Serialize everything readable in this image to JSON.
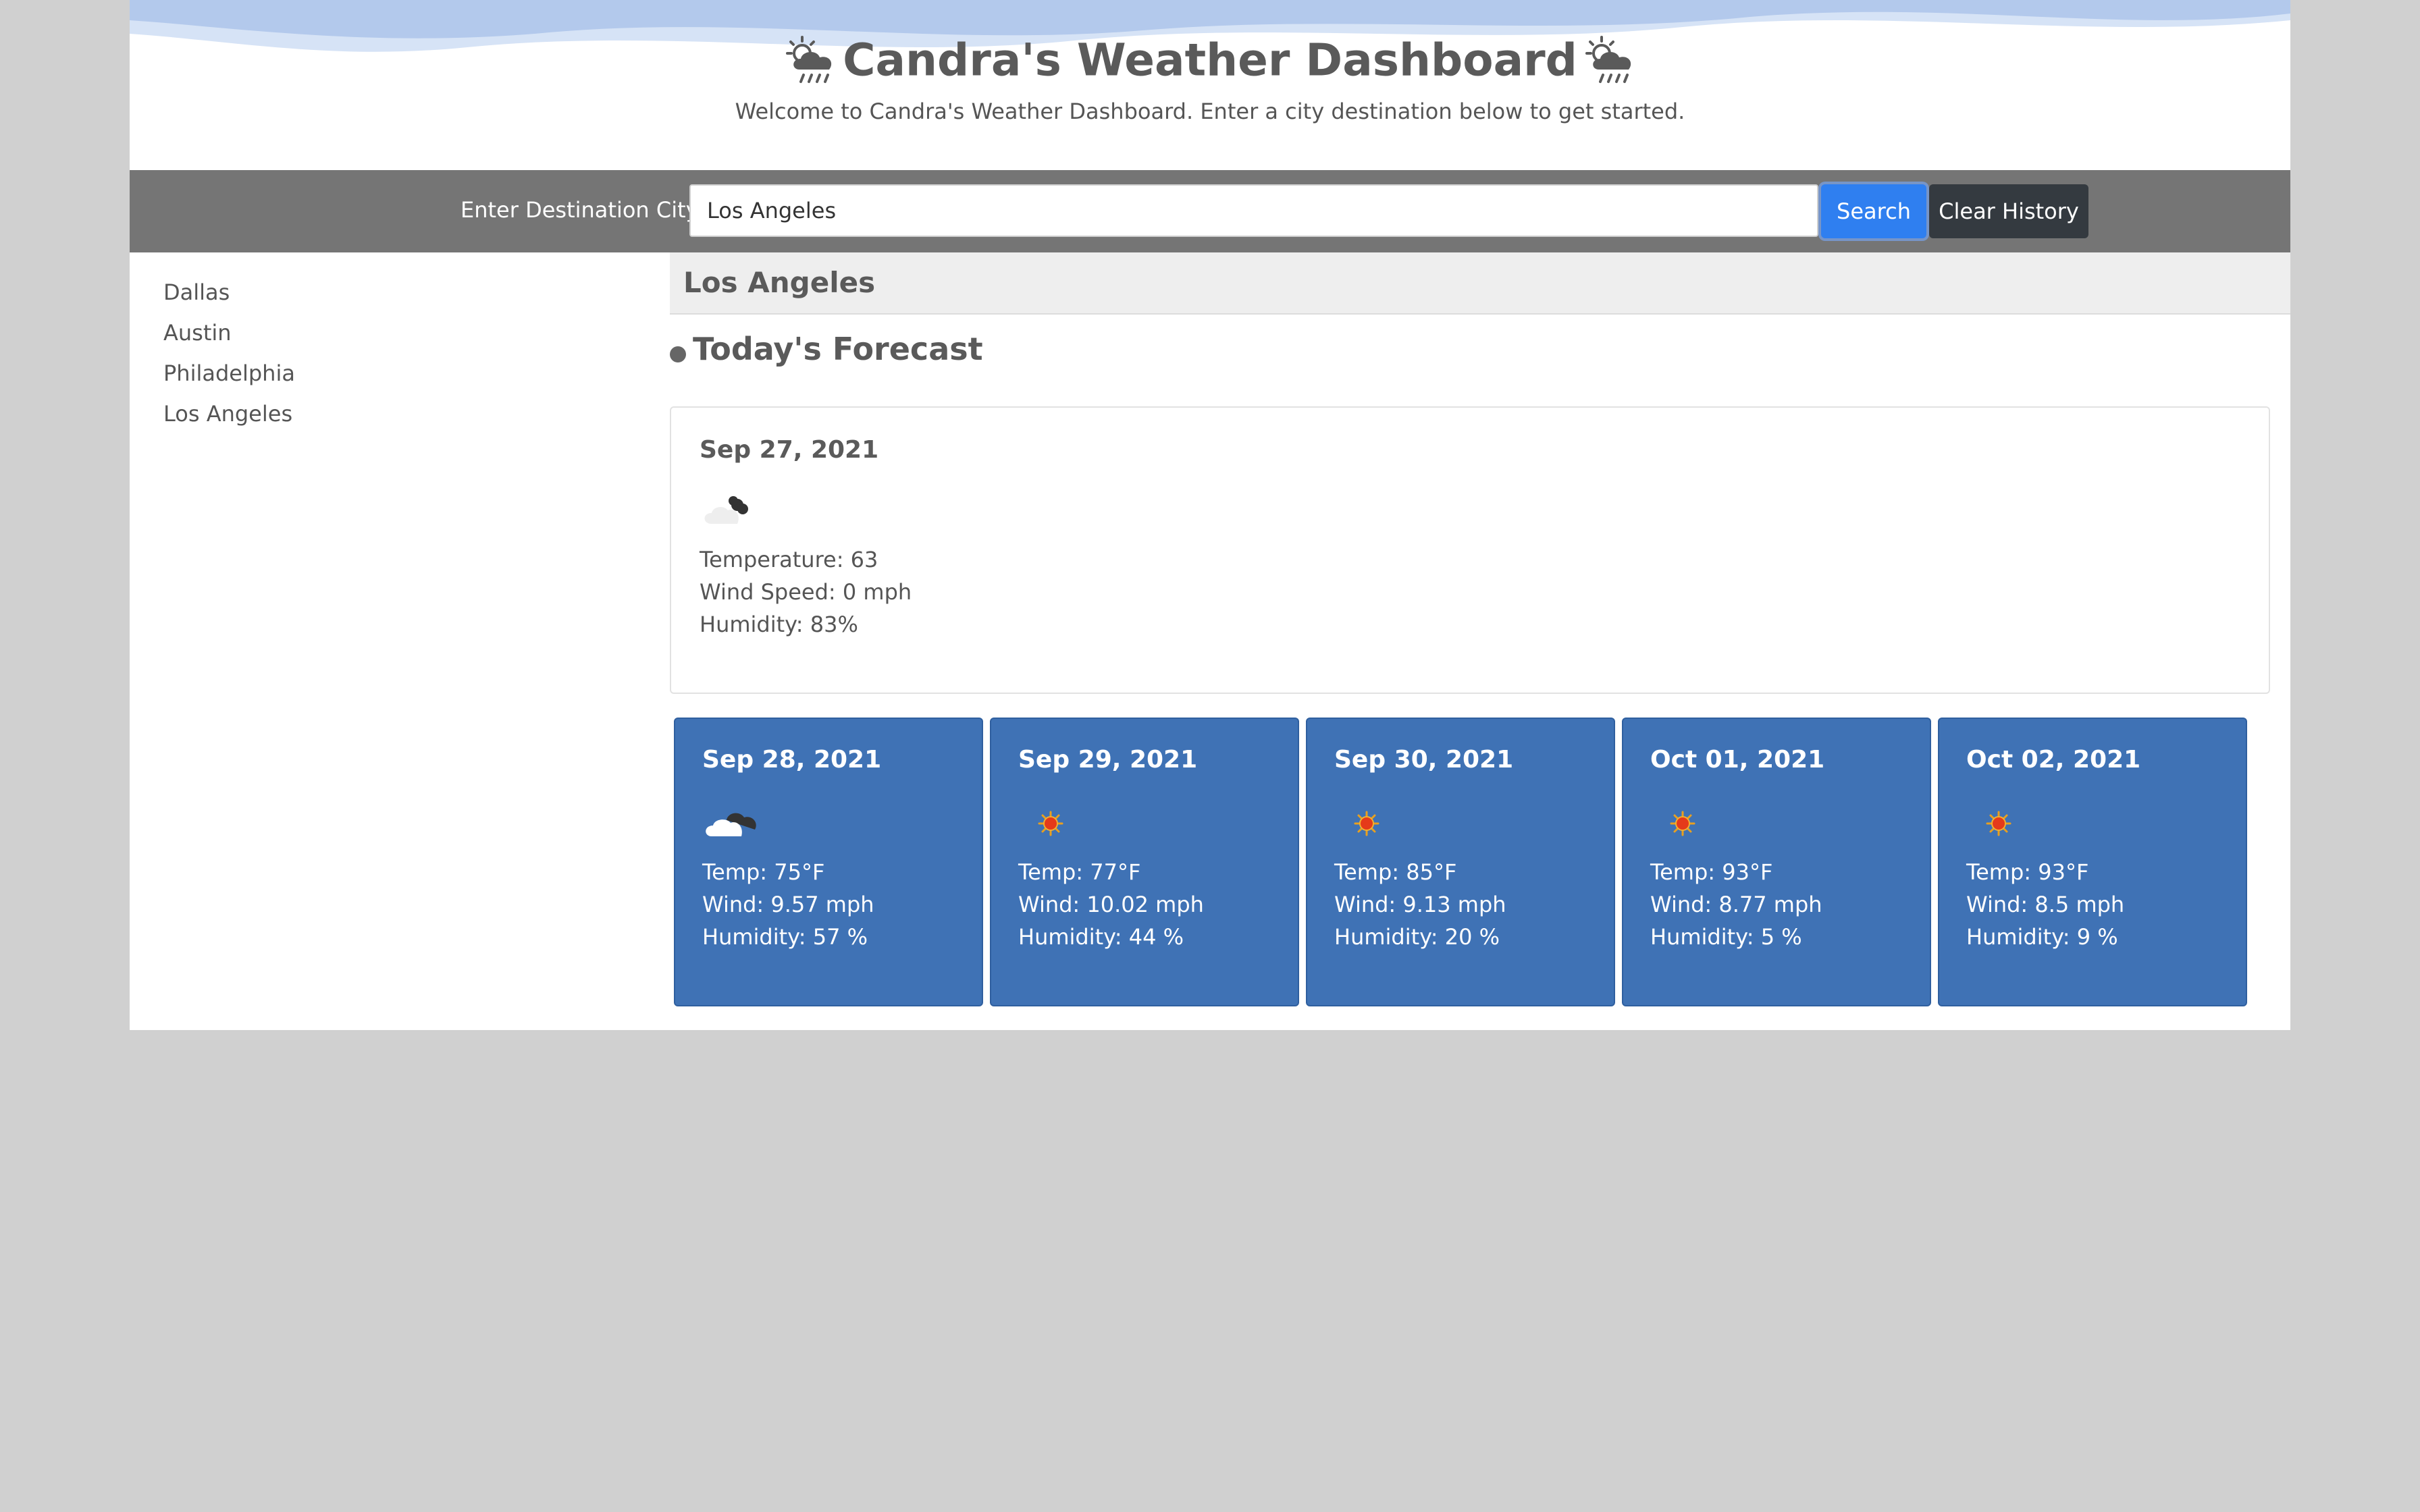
{
  "header": {
    "title": "Candra's Weather Dashboard",
    "subtitle": "Welcome to Candra's Weather Dashboard. Enter a city destination below to get started.",
    "title_icon": "sun-behind-rain-cloud-icon",
    "wave_colors": [
      "#b3c9ec",
      "#d6e3f6"
    ]
  },
  "search": {
    "label": "Enter Destination City",
    "value": "Los Angeles",
    "placeholder": "",
    "search_label": "Search",
    "clear_label": "Clear History",
    "search_color": "#2f7ff0",
    "clear_color": "#343a40"
  },
  "history": [
    "Dallas",
    "Austin",
    "Philadelphia",
    "Los Angeles"
  ],
  "current": {
    "city": "Los Angeles",
    "heading": "Today's Forecast",
    "date": "Sep 27, 2021",
    "icon": "night-cloudy-icon",
    "temperature": "Temperature: 63",
    "wind": "Wind Speed: 0 mph",
    "humidity": "Humidity: 83%"
  },
  "forecast": [
    {
      "date": "Sep 28, 2021",
      "icon": "partly-cloudy-icon",
      "temp": "Temp: 75°F",
      "wind": "Wind: 9.57 mph",
      "humidity": "Humidity: 57 %"
    },
    {
      "date": "Sep 29, 2021",
      "icon": "sun-icon",
      "temp": "Temp: 77°F",
      "wind": "Wind: 10.02 mph",
      "humidity": "Humidity: 44 %"
    },
    {
      "date": "Sep 30, 2021",
      "icon": "sun-icon",
      "temp": "Temp: 85°F",
      "wind": "Wind: 9.13 mph",
      "humidity": "Humidity: 20 %"
    },
    {
      "date": "Oct 01, 2021",
      "icon": "sun-icon",
      "temp": "Temp: 93°F",
      "wind": "Wind: 8.77 mph",
      "humidity": "Humidity: 5 %"
    },
    {
      "date": "Oct 02, 2021",
      "icon": "sun-icon",
      "temp": "Temp: 93°F",
      "wind": "Wind: 8.5 mph",
      "humidity": "Humidity: 9 %"
    }
  ],
  "colors": {
    "page_background": "#d0d0d0",
    "search_bar": "#757575",
    "forecast_card": "#3f72b5",
    "city_header": "#eeeeee"
  }
}
